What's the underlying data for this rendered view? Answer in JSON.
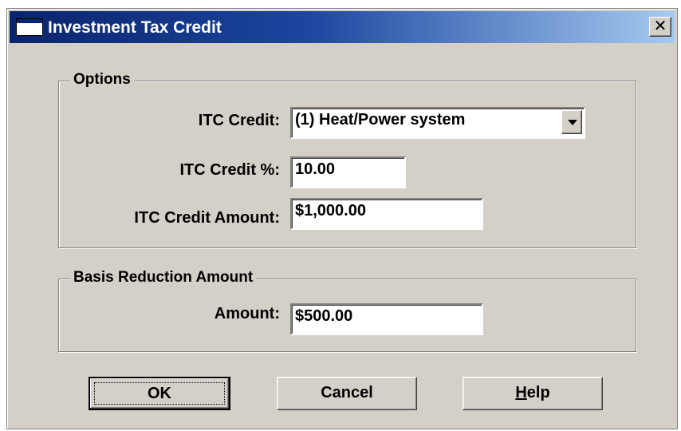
{
  "window": {
    "title": "Investment Tax Credit",
    "close_glyph": "✕"
  },
  "options_group": {
    "label": "Options",
    "itc_credit_label": "ITC Credit:",
    "itc_credit_value": "(1) Heat/Power system",
    "itc_percent_label": "ITC Credit %:",
    "itc_percent_value": "10.00",
    "itc_amount_label": "ITC Credit Amount:",
    "itc_amount_value": "$1,000.00"
  },
  "basis_group": {
    "label": "Basis Reduction Amount",
    "amount_label": "Amount:",
    "amount_value": "$500.00"
  },
  "buttons": {
    "ok_label": "OK",
    "cancel_label": "Cancel",
    "help_mnemonic": "H",
    "help_rest": "elp"
  },
  "icons": {
    "window_icon": "window-icon",
    "close_icon": "close-icon",
    "dropdown_icon": "chevron-down-icon"
  },
  "colors": {
    "titlebar_start": "#0a246a",
    "titlebar_end": "#a6caf0",
    "dialog_face": "#d4d0c8"
  }
}
